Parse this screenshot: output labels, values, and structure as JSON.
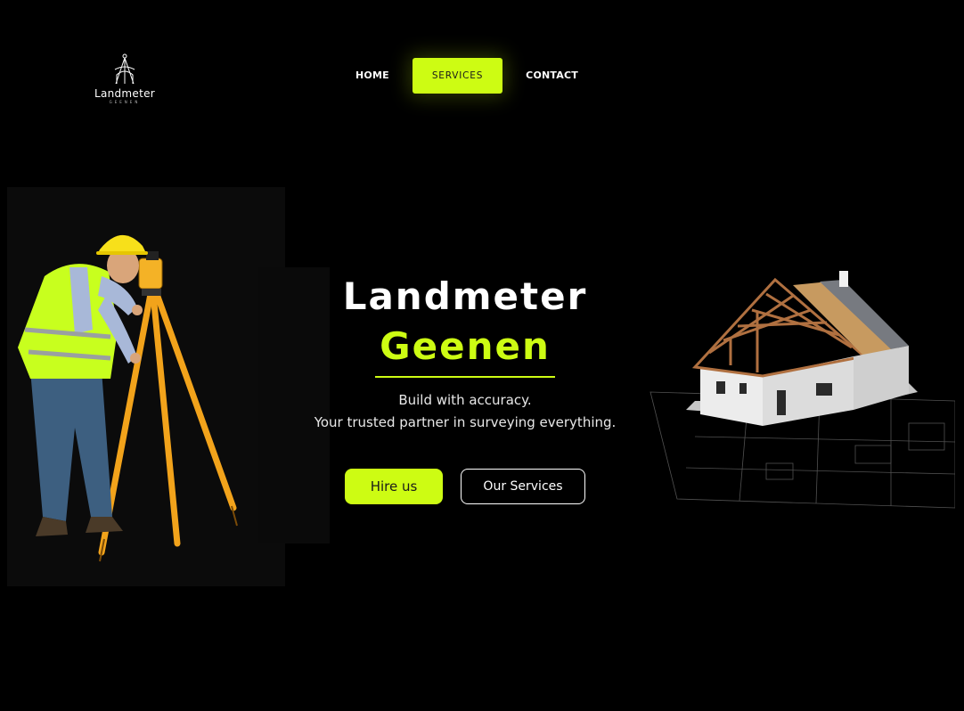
{
  "header": {
    "logo": {
      "word": "Landmeter",
      "sub": "GEENEN"
    },
    "nav": [
      {
        "label": "HOME",
        "active": false
      },
      {
        "label": "SERVICES",
        "active": true
      },
      {
        "label": "CONTACT",
        "active": false
      }
    ]
  },
  "hero": {
    "title": "Landmeter",
    "accent": "Geenen",
    "tagline_1": "Build with accuracy.",
    "tagline_2": "Your trusted partner in surveying everything.",
    "primary_button": "Hire us",
    "secondary_button": "Our Services"
  },
  "colors": {
    "accent": "#cdfc13",
    "background": "#000000",
    "text": "#ffffff"
  },
  "images": {
    "left": "surveyor-with-tripod-illustration",
    "right": "house-under-construction-on-blueprints"
  }
}
